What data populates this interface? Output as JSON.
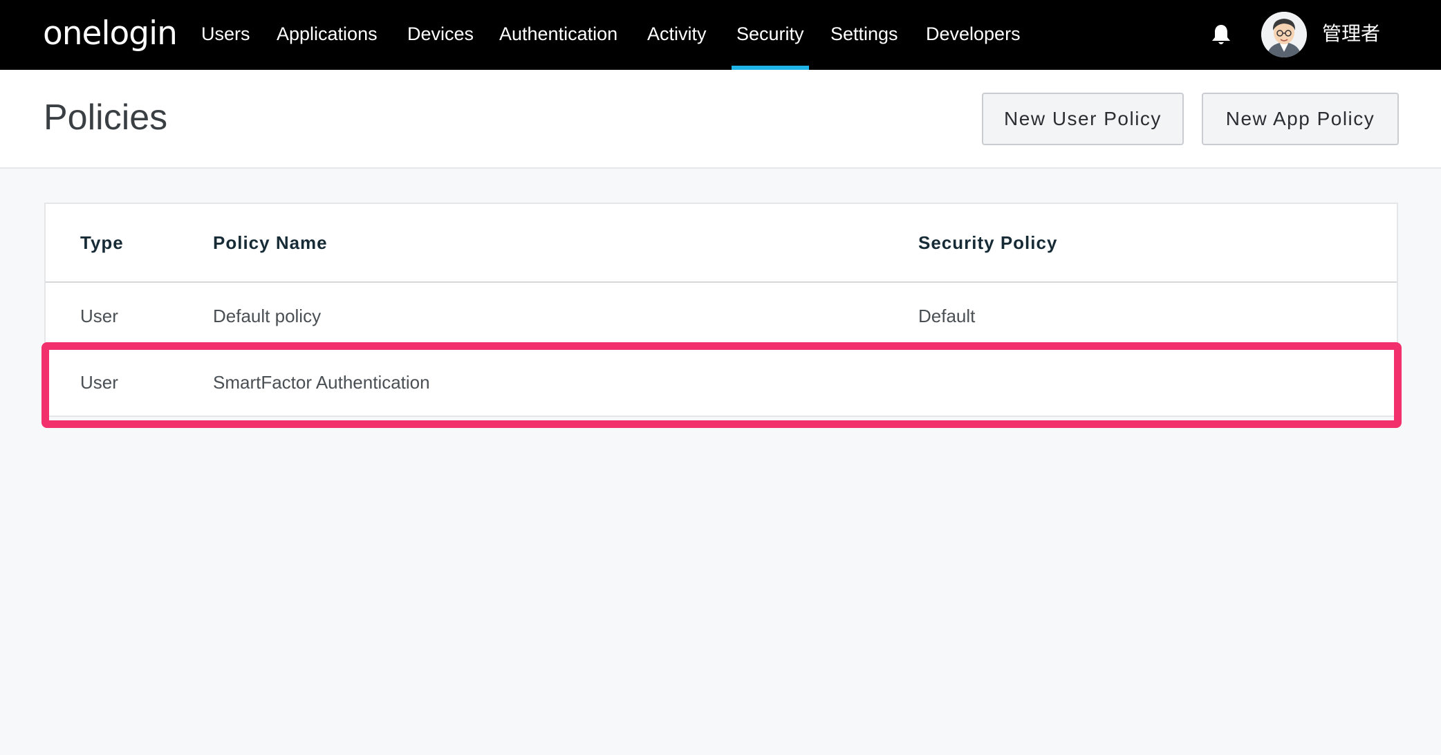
{
  "nav": {
    "logo": "onelogin",
    "items": [
      {
        "label": "Users"
      },
      {
        "label": "Applications"
      },
      {
        "label": "Devices"
      },
      {
        "label": "Authentication"
      },
      {
        "label": "Activity"
      },
      {
        "label": "Security",
        "active": true
      },
      {
        "label": "Settings"
      },
      {
        "label": "Developers"
      }
    ],
    "notification_icon": "bell-icon",
    "user": {
      "name": "管理者",
      "avatar_icon": "user-avatar"
    }
  },
  "header": {
    "title": "Policies",
    "new_user_policy_label": "New User Policy",
    "new_app_policy_label": "New App Policy"
  },
  "table": {
    "columns": [
      "Type",
      "Policy Name",
      "Security Policy"
    ],
    "rows": [
      {
        "type": "User",
        "name": "Default policy",
        "security_policy": "Default"
      },
      {
        "type": "User",
        "name": "SmartFactor Authentication",
        "security_policy": "",
        "highlighted": true
      }
    ]
  },
  "colors": {
    "nav_bg": "#000000",
    "active_tab_underline": "#1fb3e8",
    "highlight_border": "#f2306b",
    "page_bg": "#f7f8f9"
  }
}
